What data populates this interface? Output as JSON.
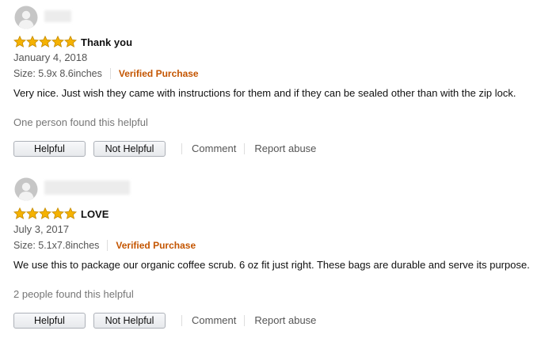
{
  "reviews": [
    {
      "rating": 5,
      "title": "Thank you",
      "date": "January 4, 2018",
      "size": "Size: 5.9x 8.6inches",
      "verified": "Verified Purchase",
      "text": "Very nice. Just wish they came with instructions for them and if they can be sealed other than with the zip lock.",
      "helpful_count": "One person found this helpful"
    },
    {
      "rating": 5,
      "title": "LOVE",
      "date": "July 3, 2017",
      "size": "Size: 5.1x7.8inches",
      "verified": "Verified Purchase",
      "text": "We use this to package our organic coffee scrub. 6 oz fit just right. These bags are durable and serve its purpose.",
      "helpful_count": "2 people found this helpful"
    }
  ],
  "actions": {
    "helpful": "Helpful",
    "not_helpful": "Not Helpful",
    "comment": "Comment",
    "report": "Report abuse"
  },
  "colors": {
    "star": "#f5b201",
    "star_outline": "#c48a00",
    "verified": "#c45500",
    "muted": "#767676",
    "avatar": "#cccccc"
  },
  "icons": {
    "avatar": "default-user-avatar-icon",
    "star": "star-icon"
  }
}
